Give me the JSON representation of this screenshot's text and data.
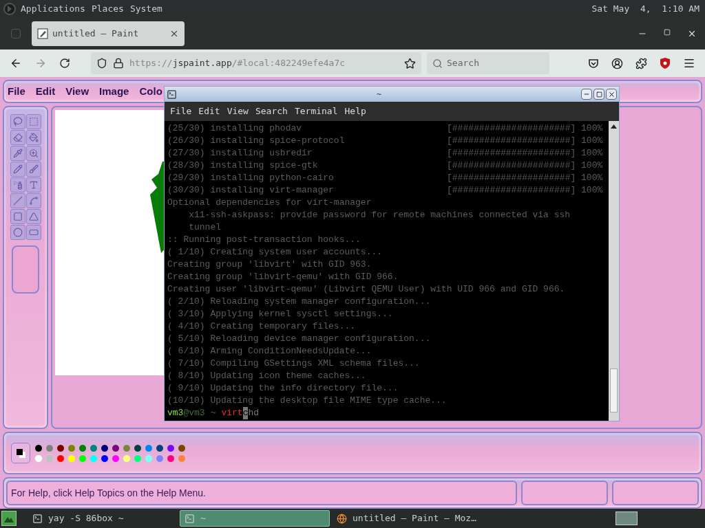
{
  "top_panel": {
    "menus": [
      "Applications",
      "Places",
      "System"
    ],
    "clock": "Sat May  4,  1:10 AM"
  },
  "browser": {
    "tabs": [
      {
        "title": "untitled — Paint",
        "selected": true
      }
    ],
    "url": {
      "scheme": "https://",
      "domain": "jspaint.app",
      "path": "/#local:482249efe4a7c"
    },
    "search": {
      "placeholder": "Search"
    }
  },
  "paint": {
    "menus": [
      "File",
      "Edit",
      "View",
      "Image",
      "Colo"
    ],
    "tools": [
      {
        "kind": "lasso"
      },
      {
        "kind": "select"
      },
      {
        "kind": "eraser"
      },
      {
        "kind": "fill"
      },
      {
        "kind": "picker"
      },
      {
        "kind": "magnifier"
      },
      {
        "kind": "pencil"
      },
      {
        "kind": "brush"
      },
      {
        "kind": "airbrush"
      },
      {
        "kind": "text"
      },
      {
        "kind": "line"
      },
      {
        "kind": "curve"
      },
      {
        "kind": "rectangle"
      },
      {
        "kind": "polygon"
      },
      {
        "kind": "ellipse"
      },
      {
        "kind": "rounded-rectangle"
      }
    ],
    "selected_colors": [
      {
        "kind": "foreground",
        "color": "#000000"
      },
      {
        "kind": "background",
        "color": "#ffffff"
      }
    ],
    "palette": [
      {
        "color": "#000000"
      },
      {
        "color": "#808080"
      },
      {
        "color": "#800000"
      },
      {
        "color": "#808000"
      },
      {
        "color": "#008000"
      },
      {
        "color": "#008080"
      },
      {
        "color": "#000080"
      },
      {
        "color": "#800080"
      },
      {
        "color": "#808040"
      },
      {
        "color": "#004040"
      },
      {
        "color": "#0080ff"
      },
      {
        "color": "#004080"
      },
      {
        "color": "#8000ff"
      },
      {
        "color": "#804000"
      },
      {
        "color": "#ffffff"
      },
      {
        "color": "#c0c0c0"
      },
      {
        "color": "#ff0000"
      },
      {
        "color": "#ffff00"
      },
      {
        "color": "#00ff00"
      },
      {
        "color": "#00ffff"
      },
      {
        "color": "#0000ff"
      },
      {
        "color": "#ff00ff"
      },
      {
        "color": "#ffff80"
      },
      {
        "color": "#00ff80"
      },
      {
        "color": "#80ffff"
      },
      {
        "color": "#8080ff"
      },
      {
        "color": "#ff0080"
      },
      {
        "color": "#ff8040"
      }
    ],
    "status": "For Help, click Help Topics on the Help Menu."
  },
  "terminal": {
    "title": "~",
    "menus": [
      "File",
      "Edit",
      "View",
      "Search",
      "Terminal",
      "Help"
    ],
    "lines": [
      {
        "text": "(25/30) installing phodav",
        "progress": "[######################] 100%"
      },
      {
        "text": "(26/30) installing spice-protocol",
        "progress": "[######################] 100%"
      },
      {
        "text": "(27/30) installing usbredir",
        "progress": "[######################] 100%"
      },
      {
        "text": "(28/30) installing spice-gtk",
        "progress": "[######################] 100%"
      },
      {
        "text": "(29/30) installing python-cairo",
        "progress": "[######################] 100%"
      },
      {
        "text": "(30/30) installing virt-manager",
        "progress": "[######################] 100%"
      },
      {
        "text": "Optional dependencies for virt-manager"
      },
      {
        "text": "    x11-ssh-askpass: provide password for remote machines connected via ssh"
      },
      {
        "text": "    tunnel"
      },
      {
        "text": ":: Running post-transaction hooks..."
      },
      {
        "text": "( 1/10) Creating system user accounts..."
      },
      {
        "text": "Creating group 'libvirt' with GID 963."
      },
      {
        "text": "Creating group 'libvirt-qemu' with GID 966."
      },
      {
        "text": "Creating user 'libvirt-qemu' (Libvirt QEMU User) with UID 966 and GID 966."
      },
      {
        "text": "( 2/10) Reloading system manager configuration..."
      },
      {
        "text": "( 3/10) Applying kernel sysctl settings..."
      },
      {
        "text": "( 4/10) Creating temporary files..."
      },
      {
        "text": "( 5/10) Reloading device manager configuration..."
      },
      {
        "text": "( 6/10) Arming ConditionNeedsUpdate..."
      },
      {
        "text": "( 7/10) Compiling GSettings XML schema files..."
      },
      {
        "text": "( 8/10) Updating icon theme caches..."
      },
      {
        "text": "( 9/10) Updating the info directory file..."
      },
      {
        "text": "(10/10) Updating the desktop file MIME type cache..."
      }
    ],
    "prompt": {
      "user": "vm3",
      "host": "@vm3",
      "cwd": "~",
      "command": "virt",
      "cursor": "c",
      "suggestion": "hd"
    }
  },
  "taskbar": {
    "tasks": [
      {
        "kind": "terminal",
        "label": "yay -S 86box ~",
        "selected": false
      },
      {
        "kind": "terminal",
        "label": "~",
        "selected": true
      },
      {
        "kind": "browser",
        "label": "untitled — Paint — Moz…",
        "selected": false
      }
    ]
  }
}
